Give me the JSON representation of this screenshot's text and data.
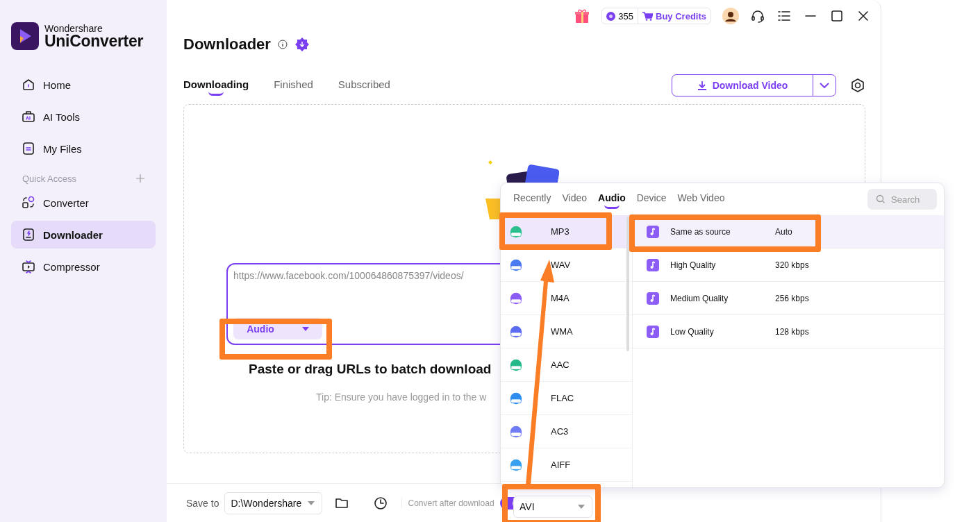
{
  "brand": {
    "company": "Wondershare",
    "product": "UniConverter"
  },
  "sidebar": {
    "items": [
      {
        "label": "Home",
        "selected": false
      },
      {
        "label": "AI Tools",
        "selected": false
      },
      {
        "label": "My Files",
        "selected": false
      }
    ],
    "quick_access": {
      "label": "Quick Access",
      "items": [
        {
          "label": "Converter",
          "selected": false
        },
        {
          "label": "Downloader",
          "selected": true
        },
        {
          "label": "Compressor",
          "selected": false
        }
      ]
    }
  },
  "top_bar": {
    "credits": "355",
    "buy_label": "Buy Credits"
  },
  "page": {
    "title": "Downloader",
    "tabs": [
      {
        "label": "Downloading",
        "selected": true
      },
      {
        "label": "Finished",
        "selected": false
      },
      {
        "label": "Subscribed",
        "selected": false
      }
    ],
    "download_button": "Download Video"
  },
  "drop_zone": {
    "url": "https://www.facebook.com/100064860875397/videos/",
    "mode": "Audio",
    "heading": "Paste or drag URLs to batch download",
    "tip": "Tip: Ensure you have logged in to the w"
  },
  "bottom_bar": {
    "save_label": "Save to",
    "save_path": "D:\\Wondershare",
    "convert_label": "Convert after download",
    "convert_on": true,
    "format": "AVI"
  },
  "format_popup": {
    "tabs": [
      {
        "label": "Recently",
        "selected": false
      },
      {
        "label": "Video",
        "selected": false
      },
      {
        "label": "Audio",
        "selected": true
      },
      {
        "label": "Device",
        "selected": false
      },
      {
        "label": "Web Video",
        "selected": false
      }
    ],
    "search_placeholder": "Search",
    "formats": [
      {
        "label": "MP3",
        "color": "#2fbf8f",
        "selected": true
      },
      {
        "label": "WAV",
        "color": "#4a7cf0",
        "selected": false
      },
      {
        "label": "M4A",
        "color": "#8a5cf5",
        "selected": false
      },
      {
        "label": "WMA",
        "color": "#5b6cf0",
        "selected": false
      },
      {
        "label": "AAC",
        "color": "#27b88a",
        "selected": false
      },
      {
        "label": "FLAC",
        "color": "#2f8cf0",
        "selected": false
      },
      {
        "label": "AC3",
        "color": "#6f7cf3",
        "selected": false
      },
      {
        "label": "AIFF",
        "color": "#3aa0f0",
        "selected": false
      }
    ],
    "qualities": [
      {
        "name": "Same as source",
        "rate": "Auto",
        "selected": true
      },
      {
        "name": "High Quality",
        "rate": "320 kbps",
        "selected": false
      },
      {
        "name": "Medium Quality",
        "rate": "256 kbps",
        "selected": false
      },
      {
        "name": "Low Quality",
        "rate": "128 kbps",
        "selected": false
      }
    ]
  }
}
